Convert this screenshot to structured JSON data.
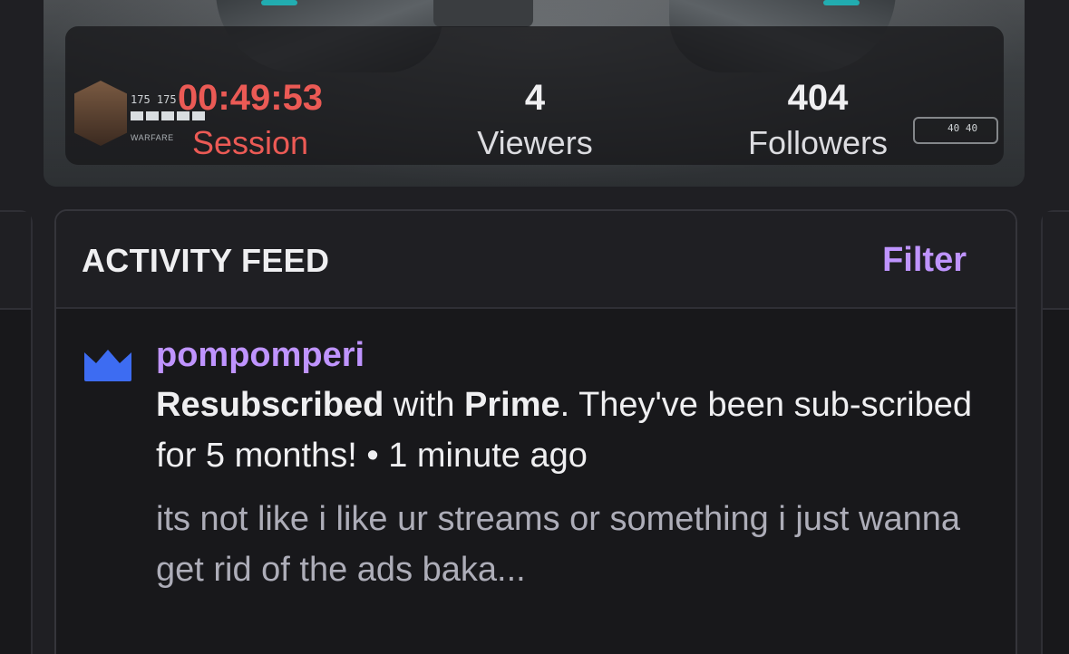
{
  "stats": {
    "session": {
      "value": "00:49:53",
      "label": "Session",
      "color": "#eb5a55"
    },
    "viewers": {
      "value": "4",
      "label": "Viewers"
    },
    "followers": {
      "value": "404",
      "label": "Followers"
    }
  },
  "game_hud": {
    "health": "175 175",
    "mode_label": "WARFARE",
    "ammo": "40 40"
  },
  "activity_feed": {
    "title": "ACTIVITY FEED",
    "filter_label": "Filter",
    "accent_color": "#bf94ff",
    "events": [
      {
        "icon": "crown-icon",
        "icon_color": "#3d6cf2",
        "username": "pompomperi",
        "action_bold": "Resubscribed",
        "with_text": " with ",
        "tier_bold": "Prime",
        "details": ". They've been sub-scribed for 5 months!",
        "separator": " • ",
        "time": "1 minute ago",
        "message": "its not like i like ur streams or something i just wanna get rid of the ads baka..."
      }
    ]
  }
}
